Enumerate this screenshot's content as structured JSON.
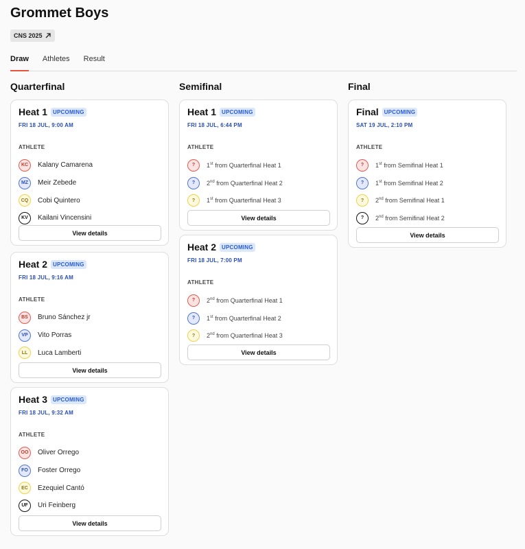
{
  "page": {
    "title": "Grommet Boys",
    "event_tag": "CNS 2025",
    "tabs": [
      "Draw",
      "Athletes",
      "Result"
    ],
    "active_tab": "Draw"
  },
  "view_details_label": "View details",
  "athlete_label": "ATHLETE",
  "colors": {
    "accent": "#e8533a",
    "badge_bg": "#dbe8fb",
    "badge_text": "#2a5bd7",
    "time_text": "#2a4fb5",
    "jersey": [
      "#e35a50",
      "#4e74db",
      "#efd24a",
      "#111111"
    ]
  },
  "columns": [
    {
      "title": "Quarterfinal",
      "heats": [
        {
          "name": "Heat 1",
          "status": "UPCOMING",
          "time": "FRI 18 JUL, 9:00 AM",
          "athletes": [
            {
              "initials": "KC",
              "name": "Kalany Camarena",
              "color": "red"
            },
            {
              "initials": "MZ",
              "name": "Meir Zebede",
              "color": "blue"
            },
            {
              "initials": "CQ",
              "name": "Cobi Quintero",
              "color": "yellow"
            },
            {
              "initials": "KV",
              "name": "Kailani Vincensini",
              "color": "black"
            }
          ]
        },
        {
          "name": "Heat 2",
          "status": "UPCOMING",
          "time": "FRI 18 JUL, 9:16 AM",
          "athletes": [
            {
              "initials": "BS",
              "name": "Bruno Sánchez jr",
              "color": "red"
            },
            {
              "initials": "VP",
              "name": "Vito Porras",
              "color": "blue"
            },
            {
              "initials": "LL",
              "name": "Luca Lamberti",
              "color": "yellow"
            }
          ]
        },
        {
          "name": "Heat 3",
          "status": "UPCOMING",
          "time": "FRI 18 JUL, 9:32 AM",
          "athletes": [
            {
              "initials": "OO",
              "name": "Oliver Orrego",
              "color": "red"
            },
            {
              "initials": "FO",
              "name": "Foster Orrego",
              "color": "blue"
            },
            {
              "initials": "EC",
              "name": "Ezequiel Cantó",
              "color": "yellow"
            },
            {
              "initials": "UF",
              "name": "Uri Feinberg",
              "color": "black"
            }
          ]
        }
      ]
    },
    {
      "title": "Semifinal",
      "heats": [
        {
          "name": "Heat 1",
          "status": "UPCOMING",
          "time": "FRI 18 JUL, 6:44 PM",
          "athletes": [
            {
              "initials": "?",
              "rank": "1",
              "suffix": "st",
              "source": "from Quarterfinal Heat 1",
              "color": "red"
            },
            {
              "initials": "?",
              "rank": "2",
              "suffix": "nd",
              "source": "from Quarterfinal Heat 2",
              "color": "blue"
            },
            {
              "initials": "?",
              "rank": "1",
              "suffix": "st",
              "source": "from Quarterfinal Heat 3",
              "color": "yellow"
            }
          ]
        },
        {
          "name": "Heat 2",
          "status": "UPCOMING",
          "time": "FRI 18 JUL, 7:00 PM",
          "athletes": [
            {
              "initials": "?",
              "rank": "2",
              "suffix": "nd",
              "source": "from Quarterfinal Heat 1",
              "color": "red"
            },
            {
              "initials": "?",
              "rank": "1",
              "suffix": "st",
              "source": "from Quarterfinal Heat 2",
              "color": "blue"
            },
            {
              "initials": "?",
              "rank": "2",
              "suffix": "nd",
              "source": "from Quarterfinal Heat 3",
              "color": "yellow"
            }
          ]
        }
      ]
    },
    {
      "title": "Final",
      "heats": [
        {
          "name": "Final",
          "status": "UPCOMING",
          "time": "SAT 19 JUL, 2:10 PM",
          "athletes": [
            {
              "initials": "?",
              "rank": "1",
              "suffix": "st",
              "source": "from Semifinal Heat 1",
              "color": "red"
            },
            {
              "initials": "?",
              "rank": "1",
              "suffix": "st",
              "source": "from Semifinal Heat 2",
              "color": "blue"
            },
            {
              "initials": "?",
              "rank": "2",
              "suffix": "nd",
              "source": "from Semifinal Heat 1",
              "color": "yellow"
            },
            {
              "initials": "?",
              "rank": "2",
              "suffix": "nd",
              "source": "from Semifinal Heat 2",
              "color": "black"
            }
          ]
        }
      ]
    }
  ]
}
